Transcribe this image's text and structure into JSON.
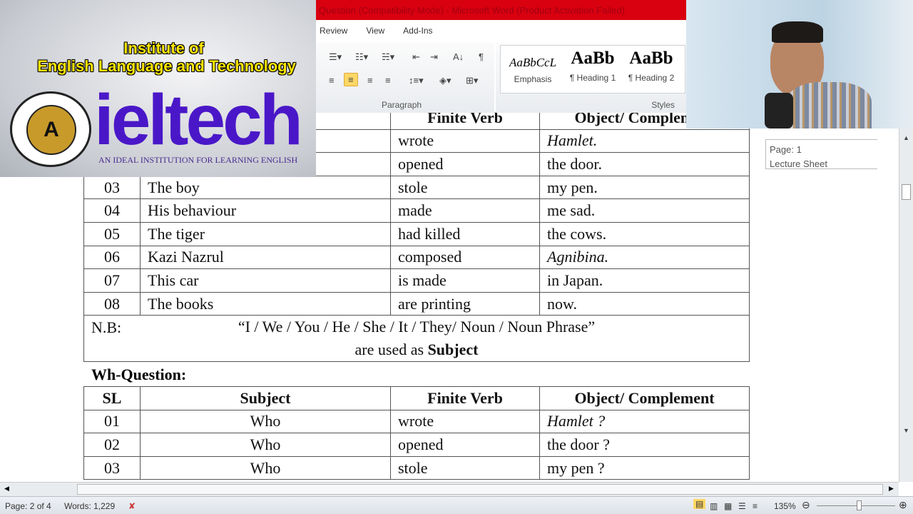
{
  "window": {
    "title": "Question (Compatibility Mode) - Microsoft Word (Product Activation Failed)"
  },
  "ribbon": {
    "tabs": [
      "Review",
      "View",
      "Add-Ins"
    ],
    "paragraph_group": "Paragraph",
    "styles_group": "Styles",
    "styles": [
      {
        "sample": "AaBbCcL",
        "name": "Emphasis"
      },
      {
        "sample": "AaBb",
        "name": "¶ Heading 1"
      },
      {
        "sample": "AaBb",
        "name": "¶ Heading 2"
      }
    ],
    "active_alignment": "center"
  },
  "logo": {
    "line1": "Institute of",
    "line2": "English Language and Technology",
    "brand": "ieltech",
    "tagline": "AN IDEAL INSTITUTION FOR LEARNING ENGLISH",
    "seal_letter": "A"
  },
  "tooltip": {
    "page": "Page: 1",
    "section": "Lecture Sheet"
  },
  "doc": {
    "table1": {
      "header": [
        "",
        "",
        "Finite Verb",
        "Object/ Complement"
      ],
      "rows": [
        {
          "sl": "",
          "subject": "",
          "verb": "wrote",
          "object": "Hamlet.",
          "italic": true
        },
        {
          "sl": "",
          "subject": "",
          "verb": "opened",
          "object": "the door."
        },
        {
          "sl": "03",
          "subject": "The boy",
          "verb": "stole",
          "object": "my pen."
        },
        {
          "sl": "04",
          "subject": "His behaviour",
          "verb": "made",
          "object": "me sad."
        },
        {
          "sl": "05",
          "subject": "The tiger",
          "verb": "had killed",
          "object": "the cows."
        },
        {
          "sl": "06",
          "subject": "Kazi Nazrul",
          "verb": "composed",
          "object": "Agnibina.",
          "italic": true
        },
        {
          "sl": "07",
          "subject": "This car",
          "verb": "is made",
          "object": "in Japan."
        },
        {
          "sl": "08",
          "subject": "The books",
          "verb": "are printing",
          "object": "now."
        }
      ],
      "nb_label": "N.B:",
      "nb_text": "“I / We / You / He / She / It / They/ Noun / Noun Phrase”",
      "nb_text2": "are used as",
      "nb_bold": "Subject"
    },
    "wh_label": "Wh-Question:",
    "table2": {
      "header": [
        "SL",
        "Subject",
        "Finite Verb",
        "Object/ Complement"
      ],
      "rows": [
        {
          "sl": "01",
          "subject": "Who",
          "verb": "wrote",
          "object": "Hamlet ?",
          "italic": true
        },
        {
          "sl": "02",
          "subject": "Who",
          "verb": "opened",
          "object": "the door ?"
        },
        {
          "sl": "03",
          "subject": "Who",
          "verb": "stole",
          "object": "my pen ?"
        }
      ]
    }
  },
  "status": {
    "page": "Page: 2 of 4",
    "words": "Words: 1,229",
    "zoom": "135%"
  },
  "colors": {
    "title_bar": "#d90010",
    "brand": "#4a17c8",
    "logo_text": "#ffe600",
    "selected_button": "#ffd765"
  }
}
